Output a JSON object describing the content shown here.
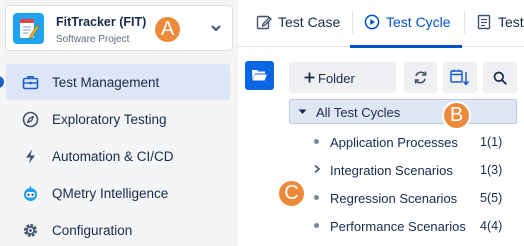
{
  "project": {
    "name": "FitTracker (FIT)",
    "type": "Software Project"
  },
  "nav": {
    "items": [
      {
        "label": "Test Management",
        "icon": "briefcase-icon",
        "active": true
      },
      {
        "label": "Exploratory Testing",
        "icon": "compass-icon"
      },
      {
        "label": "Automation & CI/CD",
        "icon": "lightning-icon"
      },
      {
        "label": "QMetry Intelligence",
        "icon": "robot-icon"
      },
      {
        "label": "Configuration",
        "icon": "gear-icon"
      }
    ]
  },
  "tabs": [
    {
      "label": "Test Case",
      "icon": "edit-icon"
    },
    {
      "label": "Test Cycle",
      "icon": "play-circle-icon",
      "active": true
    },
    {
      "label": "Test",
      "icon": "document-icon"
    }
  ],
  "toolbar": {
    "add_folder_label": "Folder"
  },
  "tree": {
    "root_label": "All Test Cycles",
    "items": [
      {
        "label": "Application Processes",
        "count": "1(1)",
        "expandable": false
      },
      {
        "label": "Integration Scenarios",
        "count": "1(3)",
        "expandable": true
      },
      {
        "label": "Regression Scenarios",
        "count": "5(5)",
        "expandable": false
      },
      {
        "label": "Performance Scenarios",
        "count": "4(4)",
        "expandable": false
      }
    ]
  },
  "markers": {
    "a": "A",
    "b": "B",
    "c": "C"
  },
  "colors": {
    "accent": "#0052cc",
    "marker": "#ec8a3a",
    "active_nav_bg": "#dde6f7",
    "logo_bg": "#1fa3f0"
  }
}
